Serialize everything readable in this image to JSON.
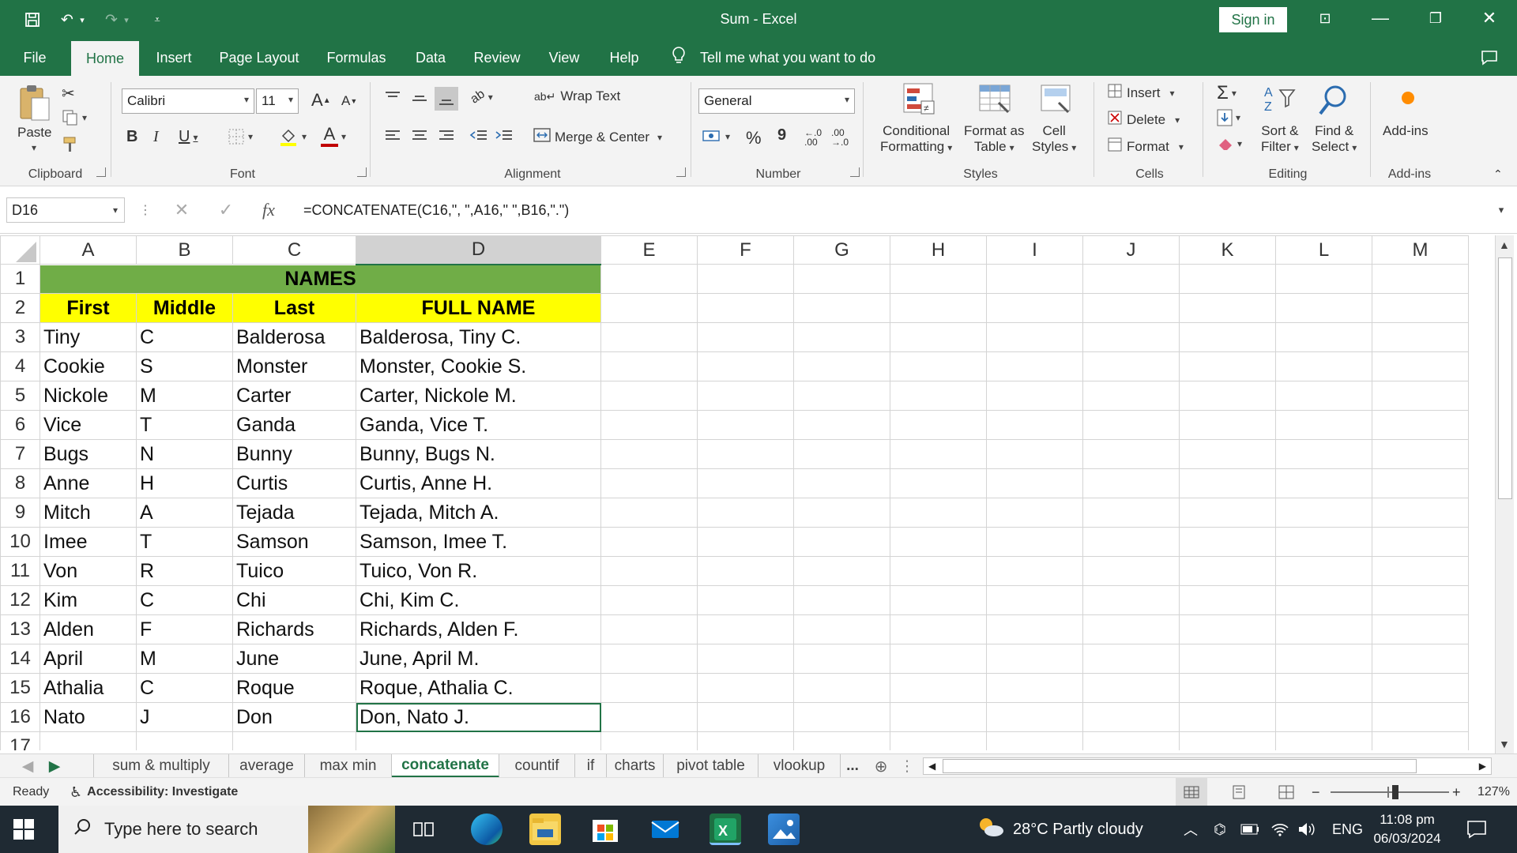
{
  "app": {
    "doc_title": "Sum  -  Excel",
    "sign_in": "Sign in"
  },
  "menu": {
    "tabs": [
      "File",
      "Home",
      "Insert",
      "Page Layout",
      "Formulas",
      "Data",
      "Review",
      "View",
      "Help"
    ],
    "active": "Home",
    "tell_me": "Tell me what you want to do"
  },
  "ribbon": {
    "clipboard": {
      "paste": "Paste",
      "label": "Clipboard"
    },
    "font": {
      "name": "Calibri",
      "size": "11",
      "label": "Font",
      "bold": "B",
      "italic": "I",
      "underline": "U",
      "grow": "A",
      "shrink": "A",
      "font_color": "A"
    },
    "alignment": {
      "wrap": "Wrap Text",
      "merge": "Merge & Center",
      "label": "Alignment"
    },
    "number": {
      "format": "General",
      "label": "Number",
      "percent": "%",
      "comma": "9",
      "inc_decimal": "←.0 .00",
      "dec_decimal": ".00 →.0"
    },
    "styles": {
      "cond1": "Conditional",
      "cond2": "Formatting",
      "fmt1": "Format as",
      "fmt2": "Table",
      "cell1": "Cell",
      "cell2": "Styles",
      "label": "Styles"
    },
    "cells": {
      "insert": "Insert",
      "delete": "Delete",
      "format": "Format",
      "label": "Cells"
    },
    "editing": {
      "sort1": "Sort &",
      "sort2": "Filter",
      "find1": "Find &",
      "find2": "Select",
      "label": "Editing"
    },
    "addins": {
      "name": "Add-ins",
      "label": "Add-ins"
    }
  },
  "formula_bar": {
    "name_box": "D16",
    "fx": "fx",
    "formula": "=CONCATENATE(C16,\", \",A16,\" \",B16,\".\")"
  },
  "grid": {
    "columns": [
      "A",
      "B",
      "C",
      "D",
      "E",
      "F",
      "G",
      "H",
      "I",
      "J",
      "K",
      "L",
      "M"
    ],
    "selected_column": "D",
    "title": "NAMES",
    "headers": [
      "First",
      "Middle",
      "Last",
      "FULL NAME"
    ],
    "rows": [
      [
        "Tiny",
        "C",
        "Balderosa",
        "Balderosa, Tiny C."
      ],
      [
        "Cookie",
        "S",
        "Monster",
        "Monster, Cookie S."
      ],
      [
        "Nickole",
        "M",
        "Carter",
        "Carter, Nickole M."
      ],
      [
        "Vice",
        "T",
        "Ganda",
        "Ganda, Vice T."
      ],
      [
        "Bugs",
        "N",
        "Bunny",
        "Bunny, Bugs N."
      ],
      [
        "Anne",
        "H",
        "Curtis",
        "Curtis, Anne H."
      ],
      [
        "Mitch",
        "A",
        "Tejada",
        "Tejada, Mitch A."
      ],
      [
        "Imee",
        "T",
        "Samson",
        "Samson, Imee T."
      ],
      [
        "Von",
        "R",
        "Tuico",
        "Tuico, Von R."
      ],
      [
        "Kim",
        "C",
        "Chi",
        "Chi, Kim C."
      ],
      [
        "Alden",
        "F",
        "Richards",
        "Richards, Alden F."
      ],
      [
        "April",
        "M",
        "June",
        "June, April M."
      ],
      [
        "Athalia",
        "C",
        "Roque",
        "Roque, Athalia C."
      ],
      [
        "Nato",
        "J",
        "Don",
        "Don, Nato J."
      ]
    ],
    "row_numbers": [
      "1",
      "2",
      "3",
      "4",
      "5",
      "6",
      "7",
      "8",
      "9",
      "10",
      "11",
      "12",
      "13",
      "14",
      "15",
      "16",
      "17"
    ]
  },
  "sheets": {
    "tabs": [
      "sum & multiply",
      "average",
      "max min",
      "concatenate",
      "countif",
      "if",
      "charts",
      "pivot table",
      "vlookup"
    ],
    "active": "concatenate",
    "more": "..."
  },
  "status": {
    "ready": "Ready",
    "accessibility": "Accessibility: Investigate",
    "zoom": "127%"
  },
  "taskbar": {
    "search_placeholder": "Type here to search",
    "weather": "28°C  Partly cloudy",
    "lang": "ENG",
    "time": "11:08 pm",
    "date": "06/03/2024"
  },
  "colors": {
    "excel_green": "#217346",
    "title_fill": "#70ad47",
    "header_fill": "#ffff00"
  }
}
